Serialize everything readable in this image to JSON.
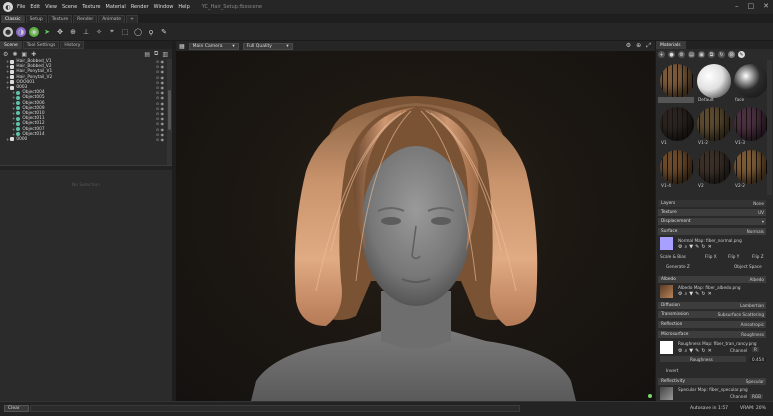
{
  "app": {
    "menu": [
      "File",
      "Edit",
      "View",
      "Scene",
      "Texture",
      "Material",
      "Render",
      "Window",
      "Help"
    ],
    "window_title": "YC_Hair_Setup.fbxscene"
  },
  "workspace_tabs": [
    "Classic",
    "Setup",
    "Texture",
    "Render",
    "Animate",
    "+"
  ],
  "left_panel": {
    "tabs": [
      "Scene",
      "Tool Settings",
      "History"
    ],
    "scene_items": [
      {
        "label": "Hair_Bobbed_V1",
        "type": "mesh",
        "indent": 1
      },
      {
        "label": "Hair_Bobbed_V2",
        "type": "mesh",
        "indent": 1
      },
      {
        "label": "Hair_Ponytail_V1",
        "type": "mesh",
        "indent": 1
      },
      {
        "label": "Hair_Ponytail_V2",
        "type": "mesh",
        "indent": 1
      },
      {
        "label": "OOO001",
        "type": "mesh",
        "indent": 1
      },
      {
        "label": "0003",
        "type": "mesh",
        "indent": 1
      },
      {
        "label": "Object004",
        "type": "group",
        "indent": 2
      },
      {
        "label": "Object005",
        "type": "group",
        "indent": 2
      },
      {
        "label": "Object006",
        "type": "group",
        "indent": 2
      },
      {
        "label": "Object009",
        "type": "group",
        "indent": 2
      },
      {
        "label": "Object010",
        "type": "group",
        "indent": 2
      },
      {
        "label": "Object011",
        "type": "group",
        "indent": 2
      },
      {
        "label": "Object012",
        "type": "group",
        "indent": 2
      },
      {
        "label": "Object007",
        "type": "group",
        "indent": 2
      },
      {
        "label": "Object014",
        "type": "group",
        "indent": 2
      },
      {
        "label": "0000",
        "type": "mesh",
        "indent": 1
      }
    ],
    "properties_empty": "No Selection"
  },
  "viewport": {
    "camera": "Main Camera",
    "quality": "Full Quality"
  },
  "materials": {
    "tab": "Materials",
    "swatches": [
      {
        "label": "24 - Default",
        "color": "#7a5a3a",
        "style": "hair"
      },
      {
        "label": "Default",
        "color": "#e0e0e0",
        "style": "sphere"
      },
      {
        "label": "face",
        "color": "#2c2c2c",
        "style": "sphere"
      },
      {
        "label": "V1",
        "color": "#2a2320",
        "style": "hair"
      },
      {
        "label": "V1-2",
        "color": "#5a4a30",
        "style": "hair"
      },
      {
        "label": "V1-3",
        "color": "#4a3040",
        "style": "hair"
      },
      {
        "label": "V1-4",
        "color": "#6a4a2a",
        "style": "hair"
      },
      {
        "label": "V2",
        "color": "#3a3028",
        "style": "hair"
      },
      {
        "label": "V2-2",
        "color": "#7a5a35",
        "style": "hair"
      }
    ],
    "layers_label": "Layers",
    "layers_value": "None",
    "texture_label": "Texture",
    "texture_value": "UV",
    "displacement_label": "Displacement",
    "surface_label": "Surface",
    "surface_value": "Normals",
    "normal_map": "Normal Map: fiber_normal.png",
    "scale_bias": "Scale & Bias",
    "flip_x": "Flip X",
    "flip_y": "Flip Y",
    "flip_z": "Flip Z",
    "generate_z": "Generate Z",
    "object_space": "Object Space",
    "albedo_label": "Albedo",
    "albedo_value": "Albedo",
    "albedo_map": "Albedo Map: fiber_albedo.png",
    "diffusion_label": "Diffusion",
    "diffusion_value": "Lambertian",
    "transmission_label": "Transmission",
    "transmission_value": "Subsurface Scattering",
    "reflection_label": "Reflection",
    "reflection_value": "Anisotropic",
    "microsurface_label": "Microsurface",
    "microsurface_value": "Roughness",
    "roughness_map": "Roughness Map: fiber_tran_rancy.png",
    "channel_label": "Channel",
    "channel_value_r": "R",
    "roughness_label": "Roughness",
    "roughness_value": "0.454",
    "invert_label": "Invert",
    "reflectivity_label": "Reflectivity",
    "reflectivity_value": "Specular",
    "specular_map": "Specular Map: fiber_specular.png",
    "channel_value_rgb": "RGB"
  },
  "status": {
    "clear": "Clear",
    "autosave": "Autosave in 1:57",
    "vram": "VRAM: 20%"
  },
  "colors": {
    "accent": "#4a86c8",
    "normal_swatch": "#a8a0ff",
    "white_swatch": "#ffffff"
  }
}
